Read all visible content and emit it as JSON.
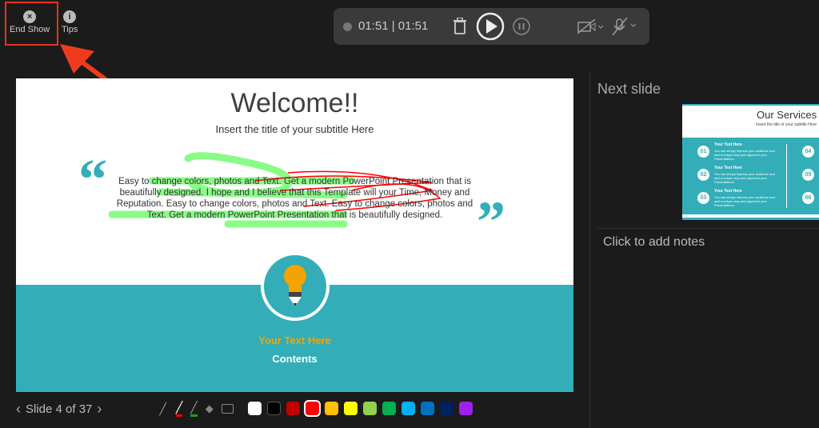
{
  "top": {
    "end_show": "End Show",
    "tips": "Tips"
  },
  "recorder": {
    "time": "01:51 | 01:51",
    "icons": [
      "record-dot",
      "trash",
      "play",
      "pause",
      "camera-off",
      "mic-off"
    ]
  },
  "slide": {
    "title": "Welcome!!",
    "subtitle": "Insert the title of your subtitle Here",
    "body": [
      "Easy to change colors, photos and Text. Get a modern PowerPoint  Presentation that is",
      "beautifully designed. I hope and I believe that this Template will your Time, Money and",
      "Reputation. Easy to change colors, photos and Text. Easy to change colors, photos and",
      "Text. Get a modern PowerPoint  Presentation that is beautifully designed."
    ],
    "highlight": "Your Text  Here",
    "contents": "Contents",
    "accent": "#33aeb8"
  },
  "nav": {
    "label": "Slide 4 of 37"
  },
  "colors": [
    "#ffffff",
    "#000000",
    "#c00000",
    "#ff0000",
    "#ffc000",
    "#ffff00",
    "#92d050",
    "#00b050",
    "#00b0f0",
    "#0070c0",
    "#002060",
    "#a020f0"
  ],
  "right": {
    "next_slide": "Next slide",
    "notes": "Click to add notes",
    "thumb": {
      "title": "Our Services",
      "subtitle": "Insert the title of your subtitle Here",
      "items": [
        {
          "num": "01",
          "head": "Your Text  Here",
          "text": "You can simply impress your audience and add a unique zing and appeal to your Presentations."
        },
        {
          "num": "02",
          "head": "Your Text  Here",
          "text": "You can simply impress your audience and add a unique zing and appeal to your Presentations."
        },
        {
          "num": "03",
          "head": "Your Text  Here",
          "text": "You can simply impress your audience and add a unique zing and appeal to your Presentations."
        }
      ],
      "right_nums": [
        "04",
        "05",
        "06"
      ]
    }
  }
}
